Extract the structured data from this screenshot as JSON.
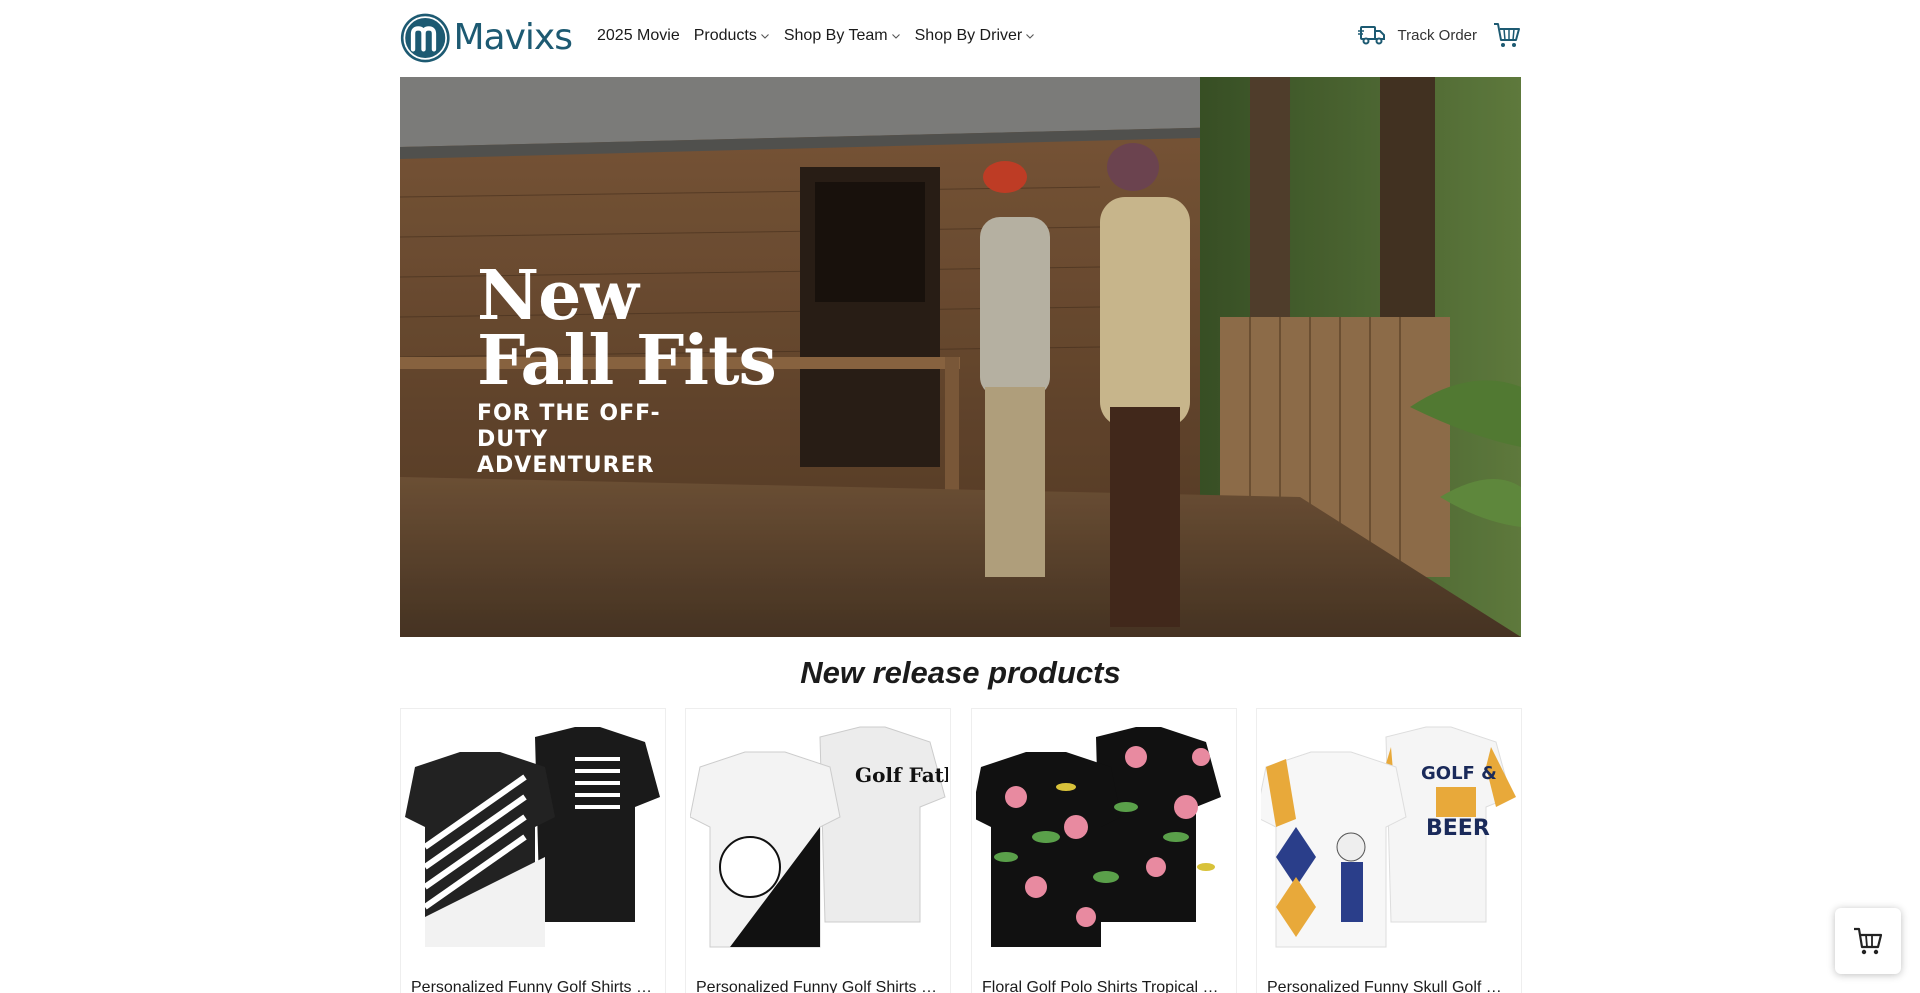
{
  "brand": {
    "name": "Mavixs",
    "color": "#1d5a72"
  },
  "nav": {
    "items": [
      {
        "label": "2025 Movie",
        "has_dropdown": false
      },
      {
        "label": "Products",
        "has_dropdown": true
      },
      {
        "label": "Shop By Team",
        "has_dropdown": true
      },
      {
        "label": "Shop By Driver",
        "has_dropdown": true
      }
    ],
    "track_order": "Track Order",
    "icons": [
      "truck-icon",
      "cart-icon"
    ]
  },
  "hero": {
    "headline_1": "New",
    "headline_2": "Fall Fits",
    "subline": "FOR THE OFF-DUTY ADVENTURER"
  },
  "section": {
    "title": "New release products"
  },
  "products": [
    {
      "title": "Personalized Funny Golf Shirts for Men"
    },
    {
      "title": "Personalized Funny Golf Shirts for Men"
    },
    {
      "title": "Floral Golf Polo Shirts Tropical Hawaiian"
    },
    {
      "title": "Personalized Funny Skull Golf Shirts"
    }
  ],
  "floating_cart": {
    "icon": "cart-icon"
  }
}
